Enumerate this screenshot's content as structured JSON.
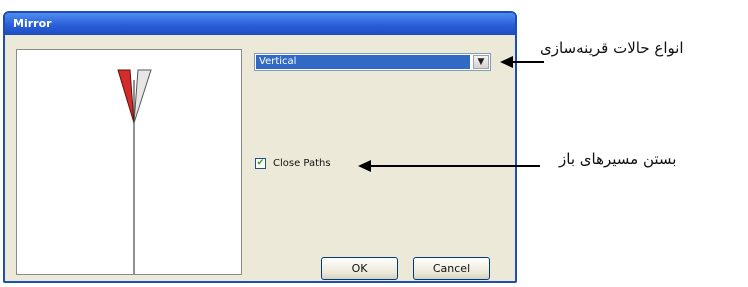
{
  "dialog": {
    "title": "Mirror",
    "mode_value": "Vertical",
    "close_paths_label": "Close Paths",
    "close_paths_checked": true,
    "ok_label": "OK",
    "cancel_label": "Cancel"
  },
  "annotations": {
    "mode_label": "انواع حالات قرینه‌سازی",
    "close_paths_label": "بستن مسیرهای باز"
  },
  "colors": {
    "title_bar": "#2a5fd8",
    "dialog_bg": "#ece9d8",
    "selection": "#316ac5",
    "shape_red": "#d42b2b"
  }
}
